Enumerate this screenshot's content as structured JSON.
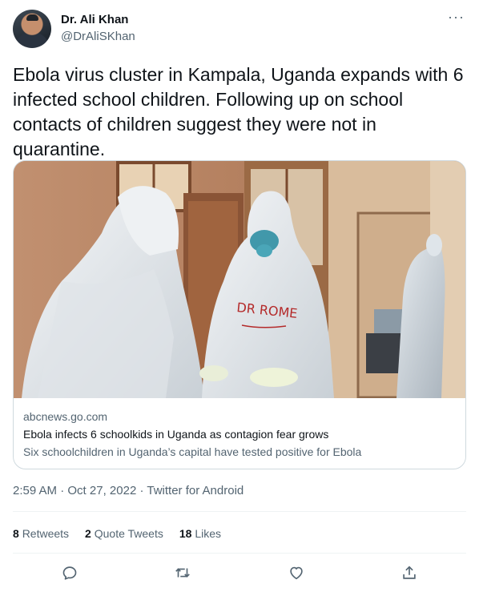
{
  "author": {
    "display_name": "Dr. Ali Khan",
    "handle": "@DrAliSKhan"
  },
  "menu": {
    "more_glyph": "···"
  },
  "tweet": {
    "text": "Ebola virus cluster in Kampala, Uganda expands with 6 infected school children. Following up on school contacts of children suggest they were not in quarantine."
  },
  "card": {
    "image_overlay_text": "DR ROME",
    "domain": "abcnews.go.com",
    "title": "Ebola infects 6 schoolkids in Uganda as contagion fear grows",
    "description": "Six schoolchildren in Uganda’s capital have tested positive for Ebola"
  },
  "meta": {
    "time": "2:59 AM",
    "separator_1": " · ",
    "date": "Oct 27, 2022",
    "separator_2": " · ",
    "source": "Twitter for Android"
  },
  "stats": {
    "retweets_count": "8",
    "retweets_label": "Retweets",
    "quotes_count": "2",
    "quotes_label": "Quote Tweets",
    "likes_count": "18",
    "likes_label": "Likes"
  },
  "actions": [
    "reply-icon",
    "retweet-icon",
    "like-icon",
    "share-icon"
  ],
  "colors": {
    "text": "#0f1419",
    "secondary": "#536471",
    "border": "#cfd9de",
    "icon": "#536471"
  }
}
